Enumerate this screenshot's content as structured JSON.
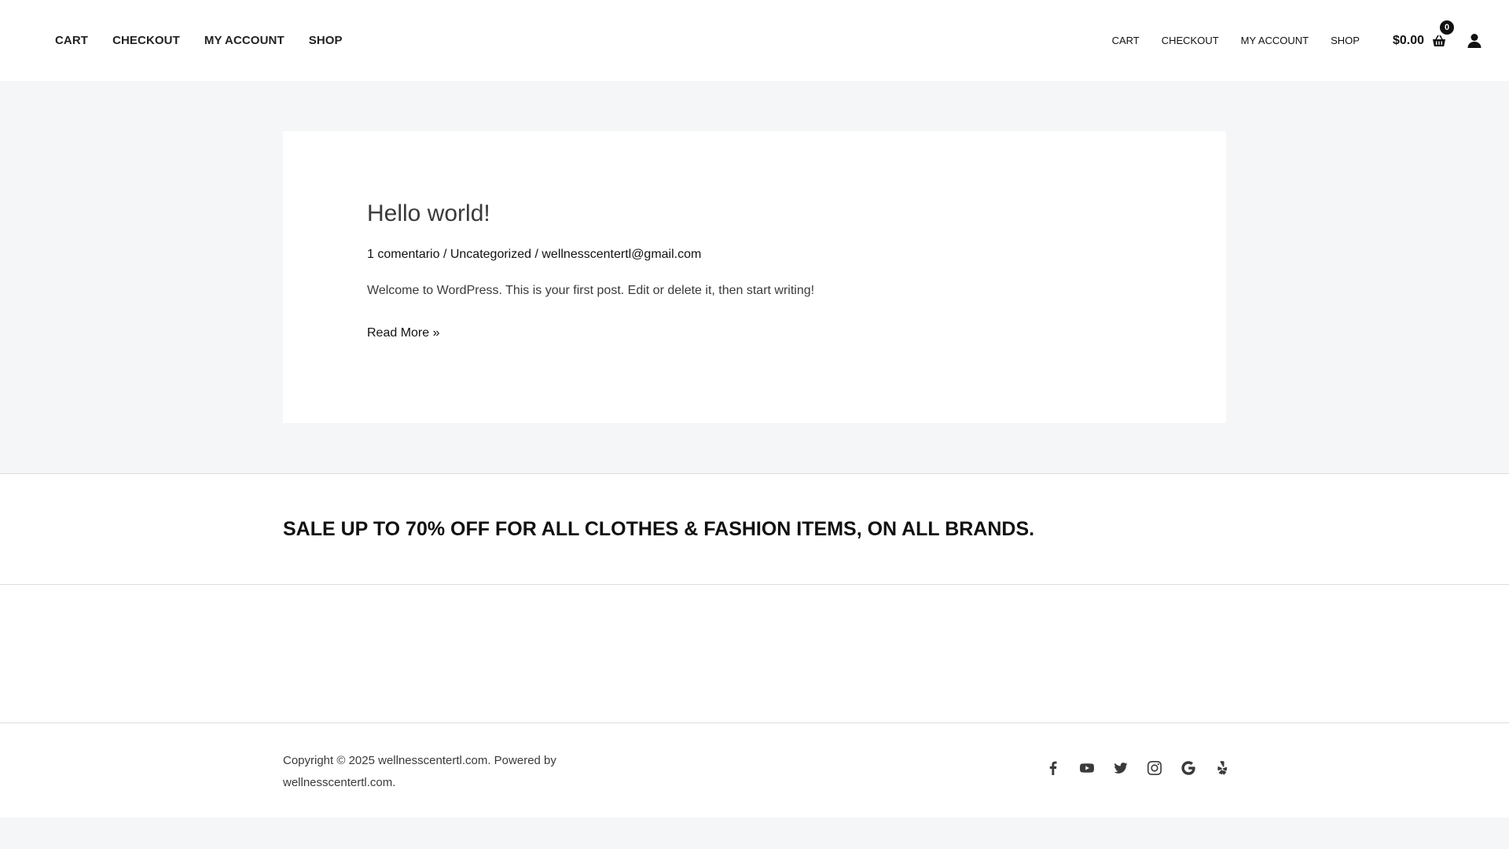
{
  "header": {
    "primary_menu": [
      "CART",
      "CHECKOUT",
      "MY ACCOUNT",
      "SHOP"
    ],
    "secondary_menu": [
      "CART",
      "CHECKOUT",
      "MY ACCOUNT",
      "SHOP"
    ],
    "cart_total": "$0.00",
    "cart_count": "0"
  },
  "post": {
    "title": "Hello world!",
    "comments": "1 comentario",
    "separator": " / ",
    "category": "Uncategorized",
    "author": "wellnesscentertl@gmail.com",
    "excerpt": "Welcome to WordPress. This is your first post. Edit or delete it, then start writing!",
    "read_more": "Read More »"
  },
  "banner": {
    "text": "SALE UP TO 70% OFF FOR ALL CLOTHES & FASHION ITEMS, ON ALL BRANDS."
  },
  "footer": {
    "copyright": "Copyright © 2025 wellnesscentertl.com. Powered by wellnesscentertl.com.",
    "social_icons": [
      "facebook-icon",
      "youtube-icon",
      "twitter-icon",
      "instagram-icon",
      "google-icon",
      "yelp-icon"
    ]
  },
  "colors": {
    "page_bg": "#f5f6f7",
    "text": "#3a3a3a",
    "link": "#111111"
  }
}
